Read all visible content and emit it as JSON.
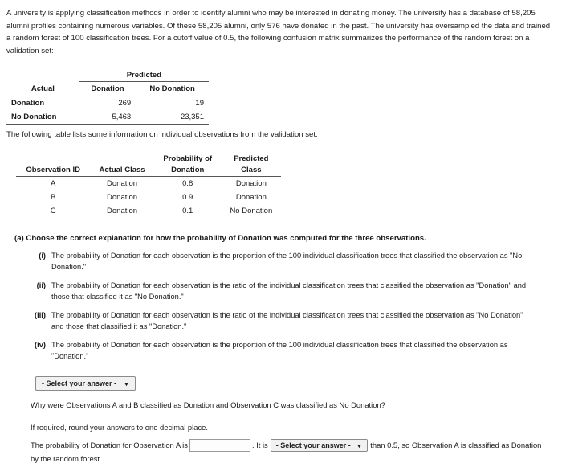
{
  "intro": {
    "paragraph": "A university is applying classification methods in order to identify alumni who may be interested in donating money. The university has a database of 58,205 alumni profiles containing numerous variables. Of these 58,205 alumni, only 576 have donated in the past. The university has oversampled the data and trained a random forest of 100 classification trees. For a cutoff value of 0.5, the following confusion matrix summarizes the performance of the random forest on a validation set:"
  },
  "confusion_matrix": {
    "predicted_header": "Predicted",
    "actual_header": "Actual",
    "columns": [
      "Donation",
      "No Donation"
    ],
    "rows": [
      {
        "label": "Donation",
        "values": [
          "269",
          "19"
        ]
      },
      {
        "label": "No Donation",
        "values": [
          "5,463",
          "23,351"
        ]
      }
    ]
  },
  "mid_text": "The following table lists some information on individual observations from the validation set:",
  "observations_table": {
    "group_header_1": "Probability of",
    "headers": [
      "Observation ID",
      "Actual Class",
      "Donation",
      "Predicted Class"
    ],
    "header_predicted_top": "Predicted",
    "header_predicted_bottom": "Class",
    "rows": [
      {
        "id": "A",
        "actual": "Donation",
        "prob": "0.8",
        "predicted": "Donation"
      },
      {
        "id": "B",
        "actual": "Donation",
        "prob": "0.9",
        "predicted": "Donation"
      },
      {
        "id": "C",
        "actual": "Donation",
        "prob": "0.1",
        "predicted": "No Donation"
      }
    ]
  },
  "question_a": {
    "label": "(a)",
    "text": "Choose the correct explanation for how the probability of Donation was computed for the three observations.",
    "choices": [
      {
        "num": "(i)",
        "text": "The probability of Donation for each observation is the proportion of the 100 individual classification trees that classified the observation as \"No Donation.\""
      },
      {
        "num": "(ii)",
        "text": "The probability of Donation for each observation is the ratio of the individual classification trees that classified the observation as \"Donation\" and those that classified it as \"No Donation.\""
      },
      {
        "num": "(iii)",
        "text": "The probability of Donation for each observation is the ratio of the individual classification trees that classified the observation as \"No Donation\" and those that classified it as \"Donation.\""
      },
      {
        "num": "(iv)",
        "text": "The probability of Donation for each observation is the proportion of the 100 individual classification trees that classified the observation as \"Donation.\""
      }
    ],
    "select_placeholder": "- Select your answer -"
  },
  "sub_question": "Why were Observations A and B classified as Donation and Observation C was classified as No Donation?",
  "round_note": "If required, round your answers to one decimal place.",
  "answer_line": {
    "prefix": "The probability of Donation for Observation A is",
    "input_value": "",
    "middle": ". It is",
    "select_placeholder": "- Select your answer -",
    "suffix": "than 0.5, so Observation A is classified as Donation",
    "tail": "by the random forest."
  }
}
